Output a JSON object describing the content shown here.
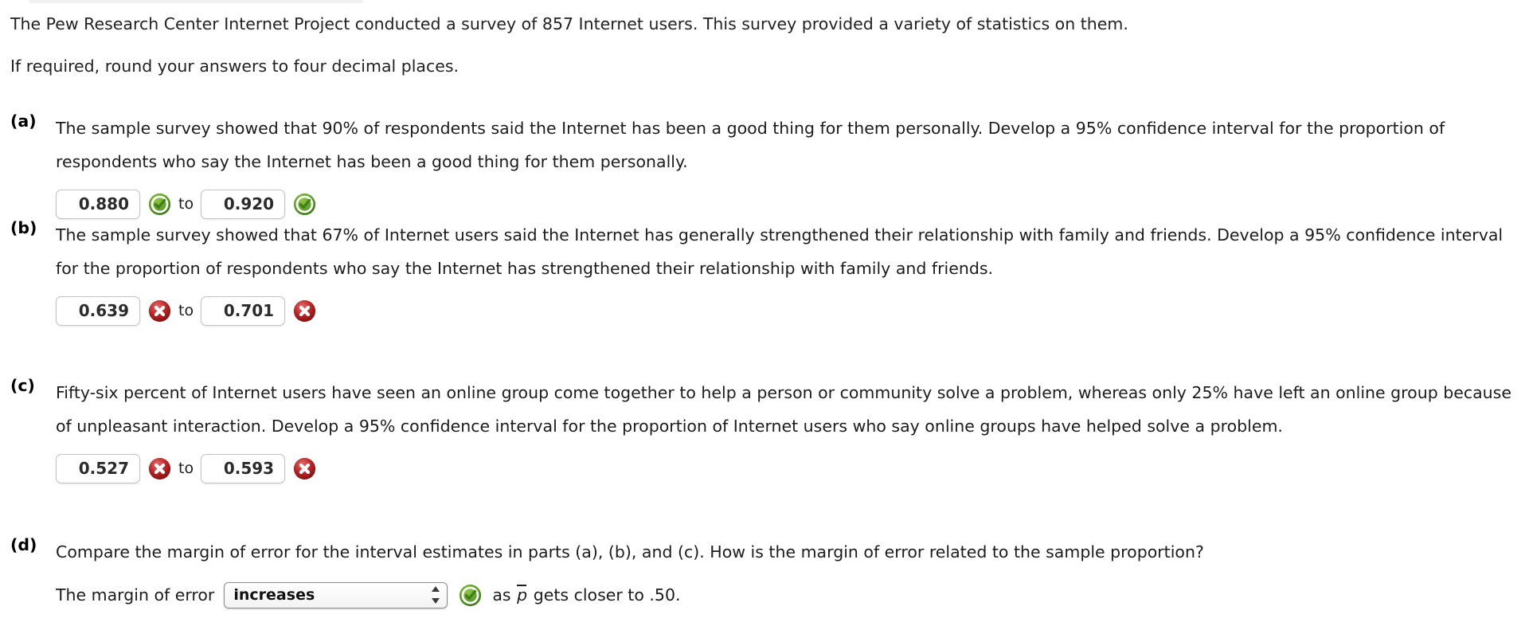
{
  "intro": {
    "line1": "The Pew Research Center Internet Project conducted a survey of 857 Internet users. This survey provided a variety of statistics on them.",
    "line2": "If required, round your answers to four decimal places."
  },
  "parts": [
    {
      "label": "(a)",
      "text": "The sample survey showed that 90% of respondents said the Internet has been a good thing for them personally. Develop a 95% confidence interval for the proportion of respondents who say the Internet has been a good thing for them personally.",
      "lower_value": "0.880",
      "lower_status": "correct-icon",
      "separator": "to",
      "upper_value": "0.920",
      "upper_status": "correct-icon"
    },
    {
      "label": "(b)",
      "text": "The sample survey showed that 67% of Internet users said the Internet has generally strengthened their relationship with family and friends. Develop a 95% confidence interval for the proportion of respondents who say the Internet has strengthened their relationship with family and friends.",
      "lower_value": "0.639",
      "lower_status": "incorrect-icon",
      "separator": "to",
      "upper_value": "0.701",
      "upper_status": "incorrect-icon"
    },
    {
      "label": "(c)",
      "text": "Fifty-six percent of Internet users have seen an online group come together to help a person or community solve a problem, whereas only 25% have left an online group because of unpleasant interaction. Develop a 95% confidence interval for the proportion of Internet users who say online groups have helped solve a problem.",
      "lower_value": "0.527",
      "lower_status": "incorrect-icon",
      "separator": "to",
      "upper_value": "0.593",
      "upper_status": "incorrect-icon"
    },
    {
      "label": "(d)",
      "text": "Compare the margin of error for the interval estimates in parts (a), (b), and (c). How is the margin of error related to the sample proportion?",
      "prompt_prefix": "The margin of error",
      "select_value": "increases",
      "select_status": "correct-icon",
      "tail_prefix": "as",
      "tail_symbol": "p",
      "tail_suffix": "gets closer to .50."
    }
  ],
  "colors": {
    "correct_green": "#4e9a25",
    "incorrect_red": "#b02121",
    "text": "#1c1c1c",
    "box_border": "#c4c4c4"
  }
}
